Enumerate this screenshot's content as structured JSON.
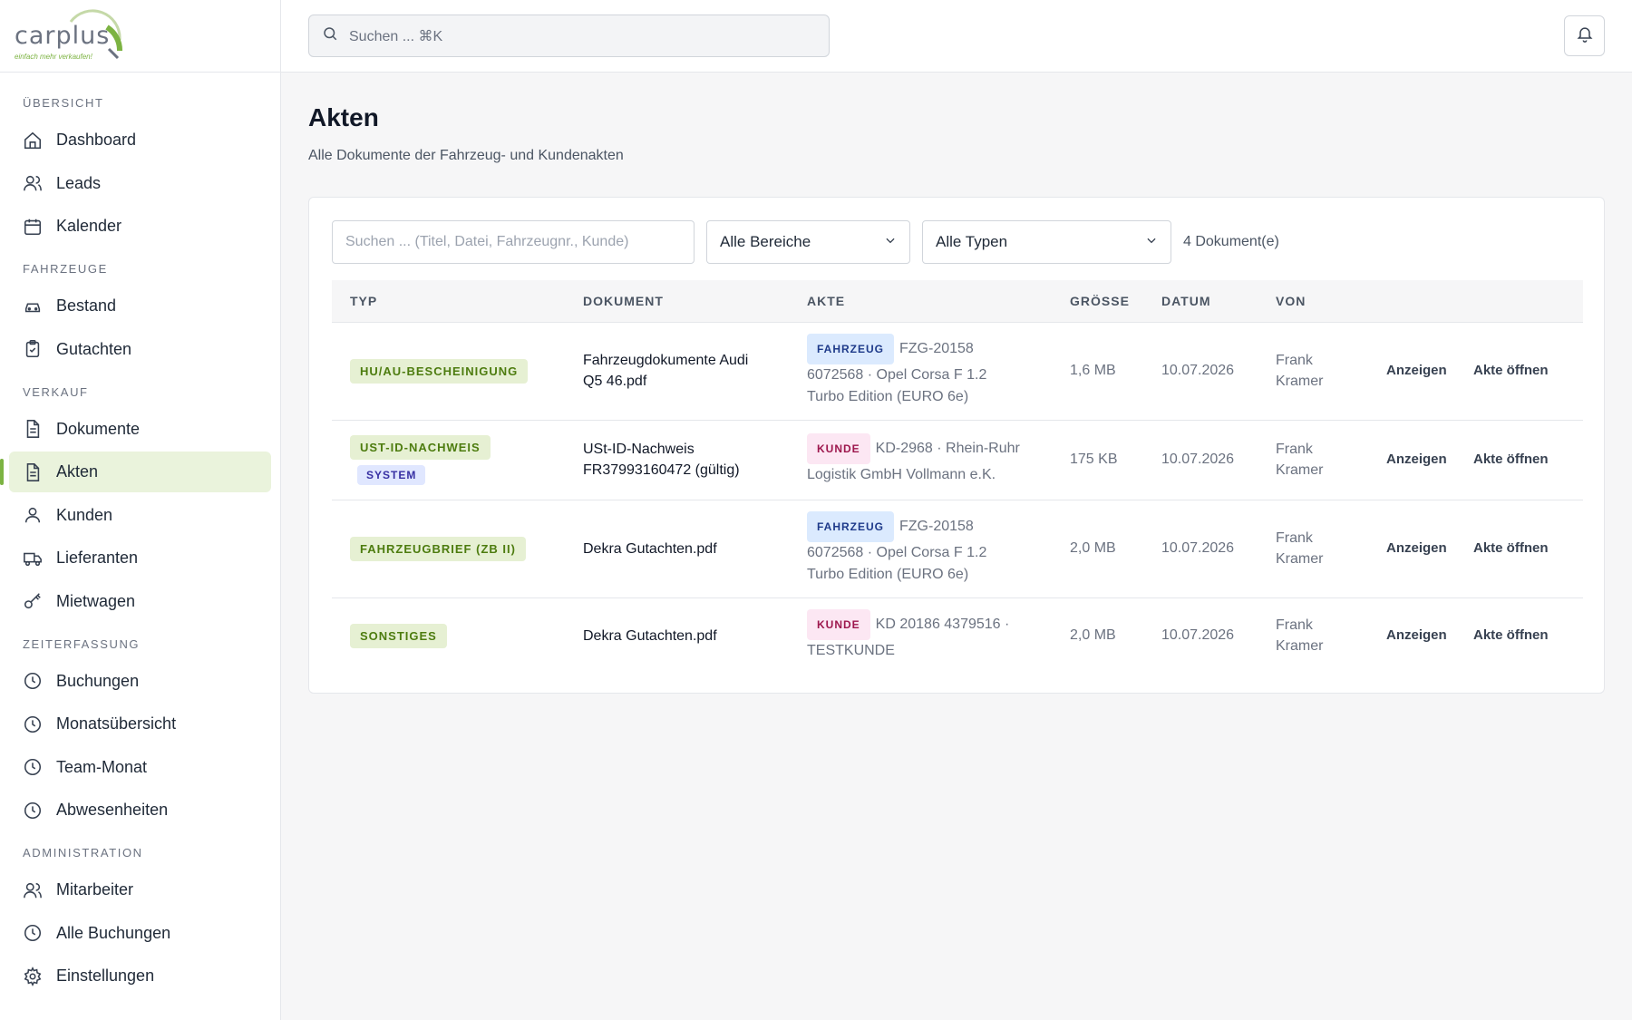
{
  "brand": {
    "name_left": "car",
    "name_right": "plus",
    "tagline": "einfach mehr verkaufen!",
    "accent": "#7cb342"
  },
  "topbar": {
    "search_placeholder": "Suchen ... ⌘K"
  },
  "sidebar": {
    "sections": [
      {
        "title": "ÜBERSICHT",
        "items": [
          {
            "label": "Dashboard",
            "icon": "home-icon"
          },
          {
            "label": "Leads",
            "icon": "users-icon"
          },
          {
            "label": "Kalender",
            "icon": "calendar-icon"
          }
        ]
      },
      {
        "title": "FAHRZEUGE",
        "items": [
          {
            "label": "Bestand",
            "icon": "car-icon"
          },
          {
            "label": "Gutachten",
            "icon": "clipboard-icon"
          }
        ]
      },
      {
        "title": "VERKAUF",
        "items": [
          {
            "label": "Dokumente",
            "icon": "document-icon"
          },
          {
            "label": "Akten",
            "icon": "document-icon",
            "active": true
          },
          {
            "label": "Kunden",
            "icon": "user-icon"
          },
          {
            "label": "Lieferanten",
            "icon": "truck-icon"
          },
          {
            "label": "Mietwagen",
            "icon": "key-icon"
          }
        ]
      },
      {
        "title": "ZEITERFASSUNG",
        "items": [
          {
            "label": "Buchungen",
            "icon": "clock-icon"
          },
          {
            "label": "Monatsübersicht",
            "icon": "clock-icon"
          },
          {
            "label": "Team-Monat",
            "icon": "clock-icon"
          },
          {
            "label": "Abwesenheiten",
            "icon": "clock-icon"
          }
        ]
      },
      {
        "title": "ADMINISTRATION",
        "items": [
          {
            "label": "Mitarbeiter",
            "icon": "users-icon"
          },
          {
            "label": "Alle Buchungen",
            "icon": "clock-icon"
          },
          {
            "label": "Einstellungen",
            "icon": "gear-icon"
          }
        ]
      }
    ]
  },
  "page": {
    "title": "Akten",
    "subtitle": "Alle Dokumente der Fahrzeug- und Kundenakten"
  },
  "filters": {
    "search_placeholder": "Suchen ... (Titel, Datei, Fahrzeugnr., Kunde)",
    "area_select": "Alle Bereiche",
    "type_select": "Alle Typen",
    "count": "4 Dokument(e)"
  },
  "table": {
    "headers": [
      "TYP",
      "DOKUMENT",
      "AKTE",
      "GRÖSSE",
      "DATUM",
      "VON"
    ],
    "rows": [
      {
        "typ": "HU/AU-BESCHEINIGUNG",
        "doc_line1": "Fahrzeugdokumente Audi",
        "doc_line2": "Q5 46.pdf",
        "ref_badge": "FAHRZEUG",
        "ref_line1": "FZG-20158",
        "ref_line2": "6072568 · Opel Corsa F 1.2",
        "ref_line3": "Turbo Edition (EURO 6e)",
        "size": "1,6 MB",
        "date": "10.07.2026",
        "von1": "Frank",
        "von2": "Kramer",
        "view": "Anzeigen",
        "open": "Akte öffnen"
      },
      {
        "typ": "UST-ID-NACHWEIS",
        "typ2": "SYSTEM",
        "doc_line1": "USt-ID-Nachweis",
        "doc_line2": "FR37993160472 (gültig)",
        "ref_badge": "KUNDE",
        "ref_line1": "KD-2968 · Rhein-Ruhr",
        "ref_line2": "Logistik GmbH Vollmann e.K.",
        "size": "175 KB",
        "date": "10.07.2026",
        "von1": "Frank",
        "von2": "Kramer",
        "view": "Anzeigen",
        "open": "Akte öffnen"
      },
      {
        "typ": "FAHRZEUGBRIEF (ZB II)",
        "doc_line1": "Dekra Gutachten.pdf",
        "ref_badge": "FAHRZEUG",
        "ref_line1": "FZG-20158",
        "ref_line2": "6072568 · Opel Corsa F 1.2",
        "ref_line3": "Turbo Edition (EURO 6e)",
        "size": "2,0 MB",
        "date": "10.07.2026",
        "von1": "Frank",
        "von2": "Kramer",
        "view": "Anzeigen",
        "open": "Akte öffnen"
      },
      {
        "typ": "SONSTIGES",
        "doc_line1": "Dekra Gutachten.pdf",
        "ref_badge": "KUNDE",
        "ref_line1": "KD 20186 4379516 ·",
        "ref_line2": "TESTKUNDE",
        "size": "2,0 MB",
        "date": "10.07.2026",
        "von1": "Frank",
        "von2": "Kramer",
        "view": "Anzeigen",
        "open": "Akte öffnen"
      }
    ]
  }
}
